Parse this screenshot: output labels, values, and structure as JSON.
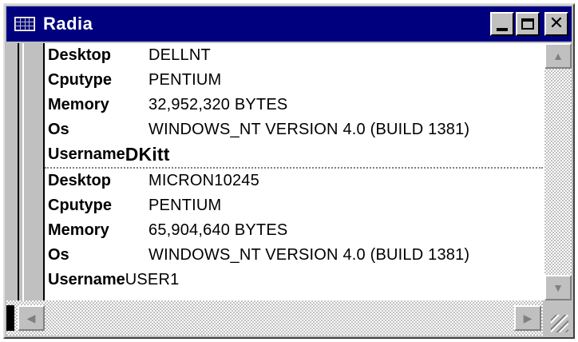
{
  "window": {
    "title": "Radia",
    "icon": "app-grid-icon",
    "controls": {
      "minimize": "minimize-icon",
      "maximize": "maximize-icon",
      "close": "✕"
    }
  },
  "records": [
    {
      "fields": [
        {
          "label": "Desktop",
          "value": "DELLNT"
        },
        {
          "label": "Cputype",
          "value": "PENTIUM"
        },
        {
          "label": "Memory",
          "value": "32,952,320 BYTES"
        },
        {
          "label": "Os",
          "value": "WINDOWS_NT VERSION 4.0 (BUILD 1381)"
        },
        {
          "label": "Username",
          "value": "DKitt"
        }
      ]
    },
    {
      "fields": [
        {
          "label": "Desktop",
          "value": "MICRON10245"
        },
        {
          "label": "Cputype",
          "value": "PENTIUM"
        },
        {
          "label": "Memory",
          "value": "65,904,640 BYTES"
        },
        {
          "label": "Os",
          "value": "WINDOWS_NT VERSION 4.0 (BUILD 1381)"
        },
        {
          "label": "Username",
          "value": "USER1"
        }
      ]
    }
  ],
  "scrollbars": {
    "up": "▲",
    "down": "▼",
    "left": "◀",
    "right": "▶"
  },
  "colors": {
    "titlebar": "#00007f",
    "face": "#c0c0c0"
  }
}
